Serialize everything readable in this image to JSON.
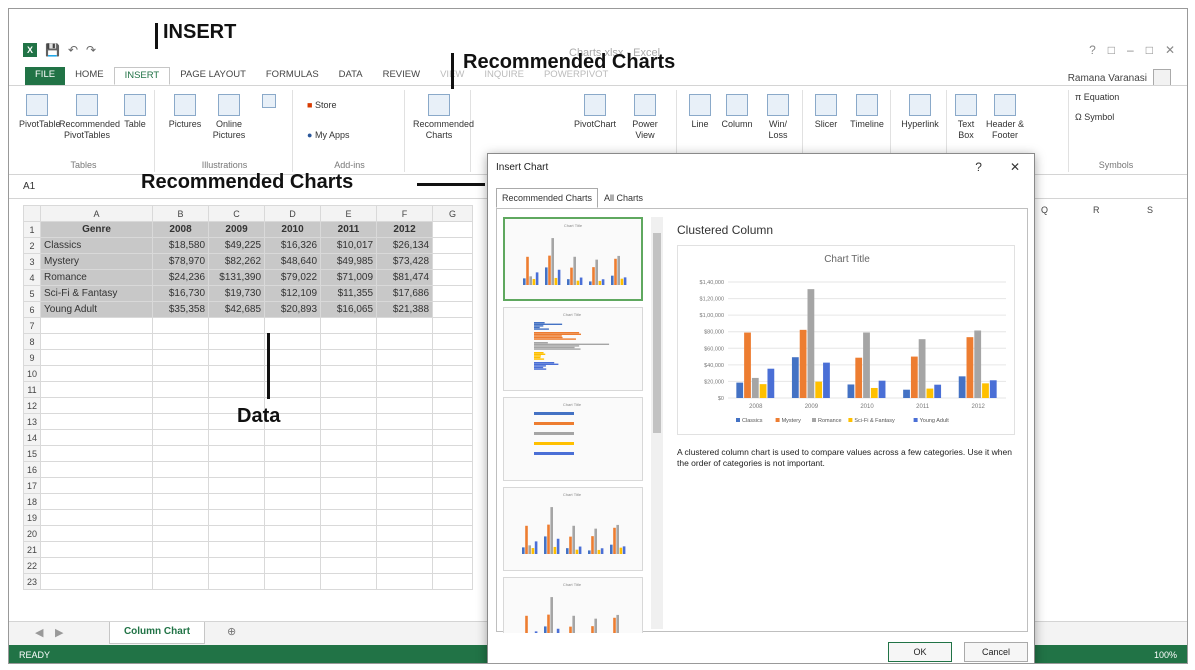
{
  "app": {
    "title": "Charts.xlsx - Excel",
    "user": "Ramana Varanasi",
    "logo": "X",
    "qat_icons": [
      "save-icon",
      "undo-icon",
      "redo-icon"
    ]
  },
  "tabs": [
    "FILE",
    "HOME",
    "INSERT",
    "PAGE LAYOUT",
    "FORMULAS",
    "DATA",
    "REVIEW",
    "VIEW",
    "INQUIRE",
    "POWERPIVOT"
  ],
  "active_tab": "INSERT",
  "ribbon": {
    "groups": [
      {
        "label": "Tables",
        "buttons": [
          "PivotTable",
          "Recommended PivotTables",
          "Table"
        ]
      },
      {
        "label": "Illustrations",
        "buttons": [
          "Pictures",
          "Online Pictures"
        ]
      },
      {
        "label": "Add-ins",
        "buttons": [
          "Store",
          "My Apps"
        ]
      },
      {
        "label": "",
        "buttons": [
          "Recommended Charts"
        ]
      },
      {
        "label": "",
        "buttons": [
          "PivotChart",
          "Power View"
        ]
      },
      {
        "label": "",
        "buttons": [
          "Line",
          "Column",
          "Win/ Loss"
        ]
      },
      {
        "label": "",
        "buttons": [
          "Slicer",
          "Timeline"
        ]
      },
      {
        "label": "",
        "buttons": [
          "Hyperlink"
        ]
      },
      {
        "label": "",
        "buttons": [
          "Text Box",
          "Header & Footer"
        ]
      },
      {
        "label": "Symbols",
        "buttons": [
          "Equation",
          "Symbol"
        ]
      }
    ]
  },
  "namebox": "A1",
  "sheet": {
    "columns": [
      "A",
      "B",
      "C",
      "D",
      "E",
      "F",
      "G"
    ],
    "right_columns": [
      "Q",
      "R",
      "S"
    ],
    "header": [
      "Genre",
      "2008",
      "2009",
      "2010",
      "2011",
      "2012"
    ],
    "rows": [
      [
        "Classics",
        "$18,580",
        "$49,225",
        "$16,326",
        "$10,017",
        "$26,134"
      ],
      [
        "Mystery",
        "$78,970",
        "$82,262",
        "$48,640",
        "$49,985",
        "$73,428"
      ],
      [
        "Romance",
        "$24,236",
        "$131,390",
        "$79,022",
        "$71,009",
        "$81,474"
      ],
      [
        "Sci-Fi & Fantasy",
        "$16,730",
        "$19,730",
        "$12,109",
        "$11,355",
        "$17,686"
      ],
      [
        "Young Adult",
        "$35,358",
        "$42,685",
        "$20,893",
        "$16,065",
        "$21,388"
      ]
    ],
    "row_numbers": [
      "1",
      "2",
      "3",
      "4",
      "5",
      "6",
      "7",
      "8",
      "9",
      "10",
      "11",
      "12",
      "13",
      "14",
      "15",
      "16",
      "17",
      "18",
      "19",
      "20",
      "21",
      "22",
      "23"
    ]
  },
  "sheet_tab": "Column Chart",
  "status": {
    "ready": "READY",
    "zoom": "100%"
  },
  "annotations": {
    "insert": "INSERT",
    "recommended_top": "Recommended Charts",
    "recommended_left": "Recommended Charts",
    "data": "Data"
  },
  "dialog": {
    "title": "Insert Chart",
    "tabs": [
      "Recommended Charts",
      "All Charts"
    ],
    "preview_title": "Clustered Column",
    "description": "A clustered column chart is used to compare values across a few categories. Use it when the order of categories is not important.",
    "ok": "OK",
    "cancel": "Cancel",
    "thumb_title": "Chart Title"
  },
  "chart_data": {
    "type": "bar",
    "title": "Chart Title",
    "categories": [
      "2008",
      "2009",
      "2010",
      "2011",
      "2012"
    ],
    "ylim": [
      0,
      140000
    ],
    "yticks": [
      "$0",
      "$20,000",
      "$40,000",
      "$60,000",
      "$80,000",
      "$1,00,000",
      "$1,20,000",
      "$1,40,000"
    ],
    "legend_position": "bottom",
    "series": [
      {
        "name": "Classics",
        "color": "#4472c4",
        "values": [
          18580,
          49225,
          16326,
          10017,
          26134
        ]
      },
      {
        "name": "Mystery",
        "color": "#ed7d31",
        "values": [
          78970,
          82262,
          48640,
          49985,
          73428
        ]
      },
      {
        "name": "Romance",
        "color": "#a5a5a5",
        "values": [
          24236,
          131390,
          79022,
          71009,
          81474
        ]
      },
      {
        "name": "Sci-Fi & Fantasy",
        "color": "#ffc000",
        "values": [
          16730,
          19730,
          12109,
          11355,
          17686
        ]
      },
      {
        "name": "Young Adult",
        "color": "#4a6fd6",
        "values": [
          35358,
          42685,
          20893,
          16065,
          21388
        ]
      }
    ]
  }
}
